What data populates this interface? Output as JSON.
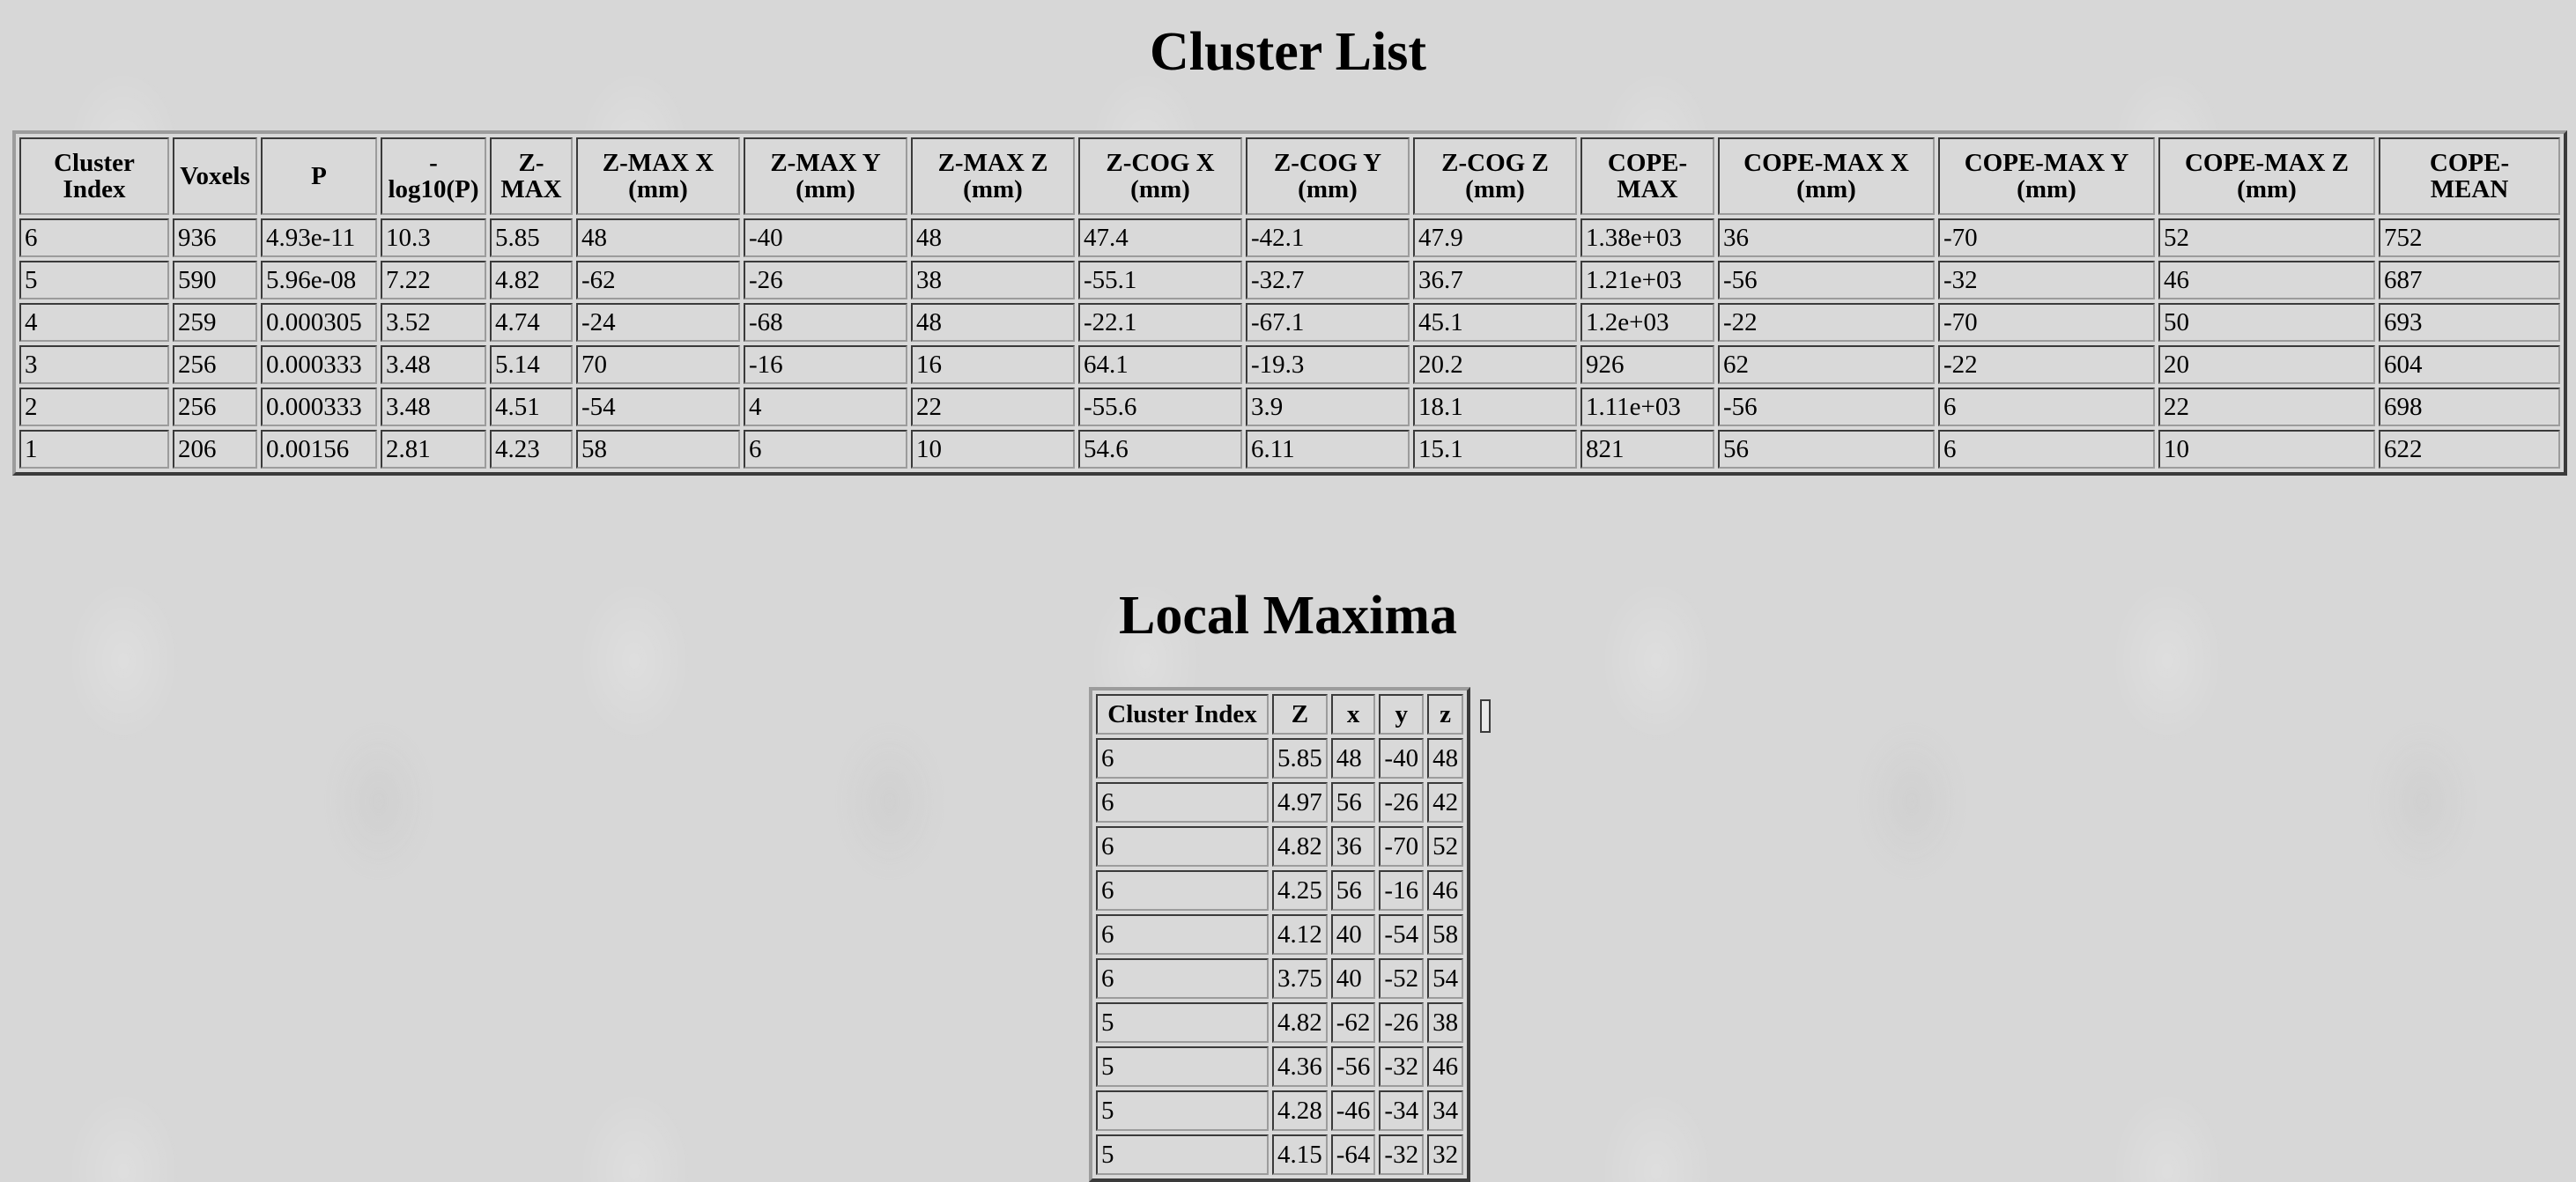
{
  "cluster_list": {
    "title": "Cluster List",
    "headers": [
      "Cluster Index",
      "Voxels",
      "P",
      "-\nlog10(P)",
      "Z-\nMAX",
      "Z-MAX X (mm)",
      "Z-MAX Y (mm)",
      "Z-MAX Z (mm)",
      "Z-COG X (mm)",
      "Z-COG Y (mm)",
      "Z-COG Z (mm)",
      "COPE-\nMAX",
      "COPE-MAX X (mm)",
      "COPE-MAX Y (mm)",
      "COPE-MAX Z (mm)",
      "COPE-\nMEAN"
    ],
    "rows": [
      [
        "6",
        "936",
        "4.93e-11",
        "10.3",
        "5.85",
        "48",
        "-40",
        "48",
        "47.4",
        "-42.1",
        "47.9",
        "1.38e+03",
        "36",
        "-70",
        "52",
        "752"
      ],
      [
        "5",
        "590",
        "5.96e-08",
        "7.22",
        "4.82",
        "-62",
        "-26",
        "38",
        "-55.1",
        "-32.7",
        "36.7",
        "1.21e+03",
        "-56",
        "-32",
        "46",
        "687"
      ],
      [
        "4",
        "259",
        "0.000305",
        "3.52",
        "4.74",
        "-24",
        "-68",
        "48",
        "-22.1",
        "-67.1",
        "45.1",
        "1.2e+03",
        "-22",
        "-70",
        "50",
        "693"
      ],
      [
        "3",
        "256",
        "0.000333",
        "3.48",
        "5.14",
        "70",
        "-16",
        "16",
        "64.1",
        "-19.3",
        "20.2",
        "926",
        "62",
        "-22",
        "20",
        "604"
      ],
      [
        "2",
        "256",
        "0.000333",
        "3.48",
        "4.51",
        "-54",
        "4",
        "22",
        "-55.6",
        "3.9",
        "18.1",
        "1.11e+03",
        "-56",
        "6",
        "22",
        "698"
      ],
      [
        "1",
        "206",
        "0.00156",
        "2.81",
        "4.23",
        "58",
        "6",
        "10",
        "54.6",
        "6.11",
        "15.1",
        "821",
        "56",
        "6",
        "10",
        "622"
      ]
    ]
  },
  "local_maxima": {
    "title": "Local Maxima",
    "headers": [
      "Cluster Index",
      "Z",
      "x",
      "y",
      "z"
    ],
    "rows": [
      [
        "6",
        "5.85",
        "48",
        "-40",
        "48"
      ],
      [
        "6",
        "4.97",
        "56",
        "-26",
        "42"
      ],
      [
        "6",
        "4.82",
        "36",
        "-70",
        "52"
      ],
      [
        "6",
        "4.25",
        "56",
        "-16",
        "46"
      ],
      [
        "6",
        "4.12",
        "40",
        "-54",
        "58"
      ],
      [
        "6",
        "3.75",
        "40",
        "-52",
        "54"
      ],
      [
        "5",
        "4.82",
        "-62",
        "-26",
        "38"
      ],
      [
        "5",
        "4.36",
        "-56",
        "-32",
        "46"
      ],
      [
        "5",
        "4.28",
        "-46",
        "-34",
        "34"
      ],
      [
        "5",
        "4.15",
        "-64",
        "-32",
        "32"
      ]
    ]
  }
}
